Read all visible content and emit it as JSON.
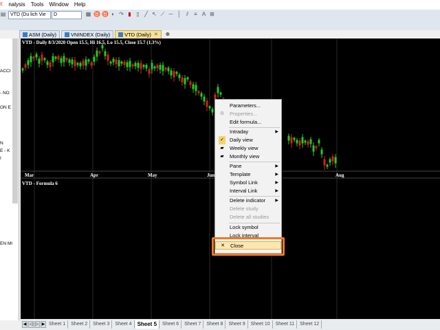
{
  "menubar": {
    "items": [
      "nalysis",
      "Tools",
      "Window",
      "Help"
    ],
    "sysicon": "ℇ"
  },
  "toolbar": {
    "symbol_value": "VTD (Du lich Vie",
    "interval_value": "D"
  },
  "tabs": [
    {
      "label": "ASM (Daily)"
    },
    {
      "label": "VNINDEX (Daily)"
    },
    {
      "label": "VTD (Daily)"
    }
  ],
  "sidebar": {
    "items": [
      "ACCI",
      "- NO",
      "ON E",
      "N",
      "E - K",
      "I",
      "EN MI"
    ]
  },
  "chart": {
    "header": "VTD - Daily 8/3/2020 Open 15.5, Hi 16.5, Lo 15.5, Close 15.7 (1.3%)",
    "formula_header": "VTD - Formula 6",
    "months": [
      "Mar",
      "Apr",
      "May",
      "Jun",
      "Aug"
    ],
    "colors": {
      "up": "#22cc22",
      "down": "#e01a1a",
      "grid": "#2a2a2a"
    }
  },
  "context_menu": {
    "items": [
      {
        "label": "Parameters...",
        "enabled": true
      },
      {
        "label": "Properties...",
        "enabled": false
      },
      {
        "label": "Edit formula...",
        "enabled": true
      },
      {
        "label": "Intraday",
        "enabled": true,
        "submenu": true
      },
      {
        "label": "Daily view",
        "enabled": true,
        "checked": true
      },
      {
        "label": "Weekly view",
        "enabled": true
      },
      {
        "label": "Monthly view",
        "enabled": true
      },
      {
        "label": "Pane",
        "enabled": true,
        "submenu": true
      },
      {
        "label": "Template",
        "enabled": true,
        "submenu": true
      },
      {
        "label": "Symbol Link",
        "enabled": true,
        "submenu": true
      },
      {
        "label": "Interval Link",
        "enabled": true,
        "submenu": true
      },
      {
        "label": "Delete indicator",
        "enabled": true,
        "submenu": true
      },
      {
        "label": "Delete study",
        "enabled": false
      },
      {
        "label": "Delete all studies",
        "enabled": false
      },
      {
        "label": "Lock symbol",
        "enabled": true
      },
      {
        "label": "Lock interval",
        "enabled": true
      },
      {
        "label": "Close",
        "enabled": true
      }
    ]
  },
  "sheets": {
    "tabs": [
      "Sheet 1",
      "Sheet 2",
      "Sheet 3",
      "Sheet 4",
      "Sheet 5",
      "Sheet 6",
      "Sheet 7",
      "Sheet 8",
      "Sheet 9",
      "Sheet 10",
      "Sheet 11",
      "Sheet 12"
    ],
    "active": "Sheet 5"
  }
}
